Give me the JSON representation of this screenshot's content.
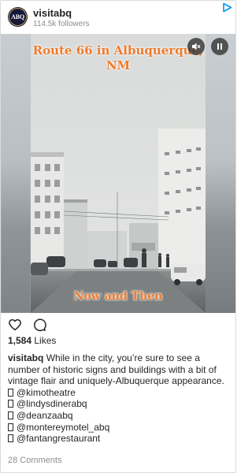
{
  "header": {
    "avatar_text": "ABQ",
    "username": "visitabq",
    "followers": "114.5k followers",
    "icons": {
      "avatar": "visitabq-logo",
      "ad": "play-triangle-icon"
    }
  },
  "media": {
    "caption_top": "Route 66 in Albuquerque, NM",
    "caption_bottom": "Now and Then",
    "icons": {
      "mute": "speaker-muted-icon",
      "pause": "pause-icon"
    }
  },
  "actions": {
    "icons": [
      "heart-icon",
      "comment-icon"
    ]
  },
  "likes": {
    "count": "1,584",
    "label": "Likes"
  },
  "description": {
    "username": "visitabq",
    "text": "While in the city, you’re sure to see a number of historic signs and buildings with a bit of vintage flair and uniquely-Albuquerque appearance.",
    "mentions": [
      "@kimotheatre",
      "@lindysdinerabq",
      "@deanzaabq",
      "@montereymotel_abq",
      "@fantangrestaurant"
    ]
  },
  "comments": {
    "label": "28 Comments"
  },
  "colors": {
    "caption": "#f07a2a",
    "text": "#262626",
    "muted": "#8e8e8e",
    "ad": "#0095f6",
    "avatar_bg": "#15193a"
  }
}
